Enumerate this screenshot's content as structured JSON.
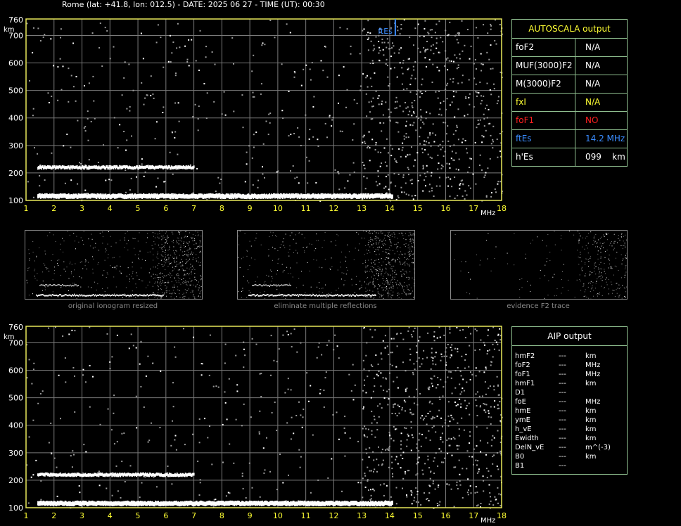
{
  "header": "Rome (lat: +41.8, lon: 012.5) - DATE: 2025 06 27 - TIME (UT): 00:30",
  "chart_data": [
    {
      "type": "scatter",
      "ylabel": "km",
      "xlabel": "MHz",
      "xlim": [
        1,
        18
      ],
      "ylim": [
        100,
        760
      ],
      "x_ticks": [
        1,
        2,
        3,
        4,
        5,
        6,
        7,
        8,
        9,
        10,
        11,
        12,
        13,
        14,
        15,
        16,
        17,
        18
      ],
      "y_ticks": [
        100,
        200,
        300,
        400,
        500,
        600,
        700,
        760
      ],
      "grid": true,
      "annotation": {
        "label": "ftEs",
        "x": 14.2
      },
      "traces": [
        {
          "name": "",
          "x_start": 1.4,
          "x_end": 14.1,
          "y": 118
        },
        {
          "name": "",
          "x_start": 1.4,
          "x_end": 7.0,
          "y": 220
        }
      ]
    },
    {
      "type": "scatter",
      "ylabel": "km",
      "xlabel": "MHz",
      "xlim": [
        1,
        18
      ],
      "ylim": [
        100,
        760
      ],
      "x_ticks": [
        1,
        2,
        3,
        4,
        5,
        6,
        7,
        8,
        9,
        10,
        11,
        12,
        13,
        14,
        15,
        16,
        17,
        18
      ],
      "y_ticks": [
        100,
        200,
        300,
        400,
        500,
        600,
        700,
        760
      ],
      "grid": true,
      "traces": [
        {
          "name": "",
          "x_start": 1.4,
          "x_end": 14.1,
          "y": 118
        },
        {
          "name": "",
          "x_start": 1.4,
          "x_end": 7.0,
          "y": 220
        }
      ]
    }
  ],
  "autoscala": {
    "title": "AUTOSCALA output",
    "rows": [
      {
        "key": "foF2",
        "value": "N/A",
        "key_color": "#ffffff",
        "value_color": "#ffffff"
      },
      {
        "key": "MUF(3000)F2",
        "value": "N/A",
        "key_color": "#ffffff",
        "value_color": "#ffffff"
      },
      {
        "key": "M(3000)F2",
        "value": "N/A",
        "key_color": "#ffffff",
        "value_color": "#ffffff"
      },
      {
        "key": "fxI",
        "value": "N/A",
        "key_color": "#ffff33",
        "value_color": "#ffff33"
      },
      {
        "key": "foF1",
        "value": "NO",
        "key_color": "#ff2020",
        "value_color": "#ff2020"
      },
      {
        "key": "ftEs",
        "value": "14.2 MHz",
        "key_color": "#3a8cff",
        "value_color": "#3a8cff"
      },
      {
        "key": "h'Es",
        "value": "099    km",
        "key_color": "#ffffff",
        "value_color": "#ffffff"
      }
    ]
  },
  "aip": {
    "title": "AIP output",
    "rows": [
      {
        "key": "hmF2",
        "value": "---",
        "unit": "km"
      },
      {
        "key": "foF2",
        "value": "---",
        "unit": "MHz"
      },
      {
        "key": "foF1",
        "value": "---",
        "unit": "MHz"
      },
      {
        "key": "hmF1",
        "value": "---",
        "unit": "km"
      },
      {
        "key": "D1",
        "value": "---",
        "unit": ""
      },
      {
        "key": "foE",
        "value": "---",
        "unit": "MHz"
      },
      {
        "key": "hmE",
        "value": "---",
        "unit": "km"
      },
      {
        "key": "ymE",
        "value": "---",
        "unit": "km"
      },
      {
        "key": "h_vE",
        "value": "---",
        "unit": "km"
      },
      {
        "key": "Ewidth",
        "value": "---",
        "unit": "km"
      },
      {
        "key": "DelN_vE",
        "value": "---",
        "unit": "m^(-3)"
      },
      {
        "key": "B0",
        "value": "---",
        "unit": "km"
      },
      {
        "key": "B1",
        "value": "---",
        "unit": ""
      }
    ]
  },
  "thumbnails": [
    {
      "caption": "original ionogram resized"
    },
    {
      "caption": "eliminate multiple reflections"
    },
    {
      "caption": "evidence F2 trace"
    }
  ],
  "colors": {
    "axis": "#e8e85a",
    "grid": "#7a7a7a",
    "tick_label": "#ffff33",
    "table_border": "#8fbf8f",
    "ftEs": "#3a8cff"
  }
}
